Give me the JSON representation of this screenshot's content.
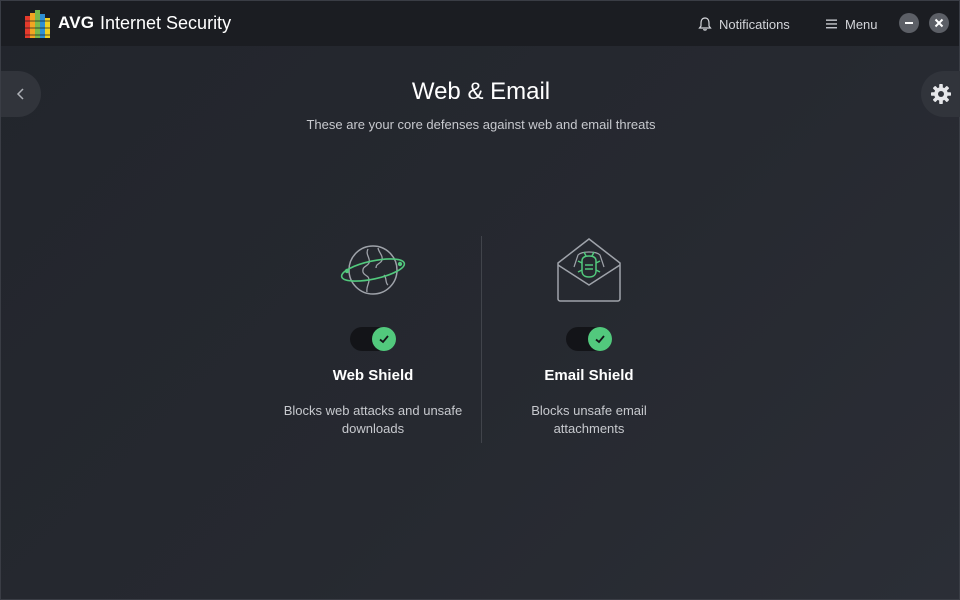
{
  "app": {
    "brand": "AVG",
    "product": "Internet Security"
  },
  "titlebar": {
    "notifications_label": "Notifications",
    "menu_label": "Menu"
  },
  "page": {
    "title": "Web & Email",
    "subtitle": "These are your core defenses against web and email threats"
  },
  "shields": [
    {
      "name": "Web Shield",
      "description": "Blocks web attacks and unsafe downloads",
      "enabled": true,
      "icon": "globe-icon"
    },
    {
      "name": "Email Shield",
      "description": "Blocks unsafe email attachments",
      "enabled": true,
      "icon": "envelope-bug-icon"
    }
  ],
  "colors": {
    "accent_green": "#52c97d",
    "background": "#23262d",
    "titlebar": "#1b1d22"
  }
}
